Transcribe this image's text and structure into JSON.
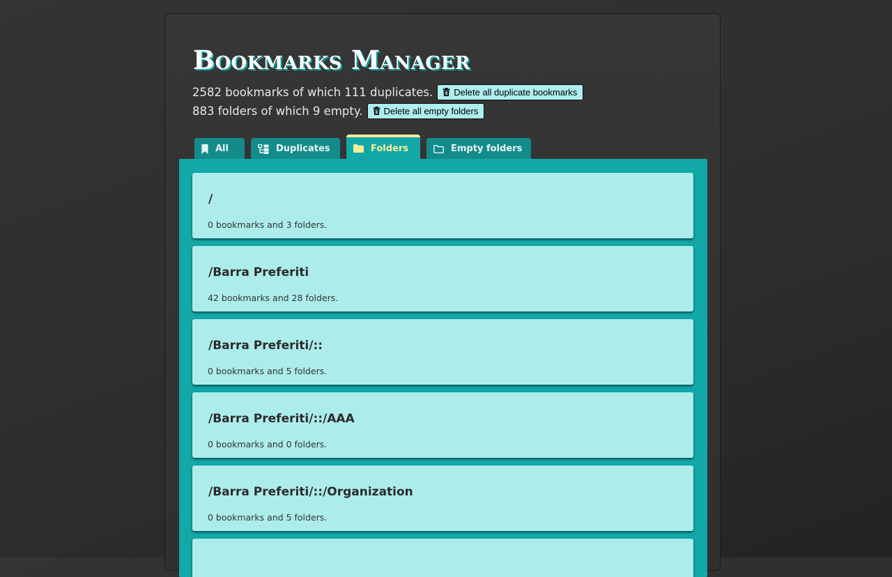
{
  "header": {
    "title": "Bookmarks Manager",
    "bookmarks_summary": "2582 bookmarks of which 111 duplicates.",
    "delete_duplicates_label": "Delete all duplicate bookmarks",
    "folders_summary": "883 folders of which 9 empty.",
    "delete_empty_label": "Delete all empty folders"
  },
  "tabs": [
    {
      "label": "All",
      "icon": "bookmark-icon",
      "active": false
    },
    {
      "label": "Duplicates",
      "icon": "duplicates-icon",
      "active": false
    },
    {
      "label": "Folders",
      "icon": "folder-icon",
      "active": true
    },
    {
      "label": "Empty folders",
      "icon": "empty-folder-icon",
      "active": false
    }
  ],
  "folders": [
    {
      "path": "/",
      "info": "0 bookmarks and 3 folders."
    },
    {
      "path": "/Barra Preferiti",
      "info": "42 bookmarks and 28 folders."
    },
    {
      "path": "/Barra Preferiti/::",
      "info": "0 bookmarks and 5 folders."
    },
    {
      "path": "/Barra Preferiti/::/AAA",
      "info": "0 bookmarks and 0 folders."
    },
    {
      "path": "/Barra Preferiti/::/Organization",
      "info": "0 bookmarks and 5 folders."
    },
    {
      "path": "",
      "info": ""
    }
  ],
  "colors": {
    "accent": "#13a8a8",
    "tab_inactive": "#148b8b",
    "card": "#acedec",
    "active_tab_text": "#f9ee9a",
    "button": "#aeeeee"
  }
}
